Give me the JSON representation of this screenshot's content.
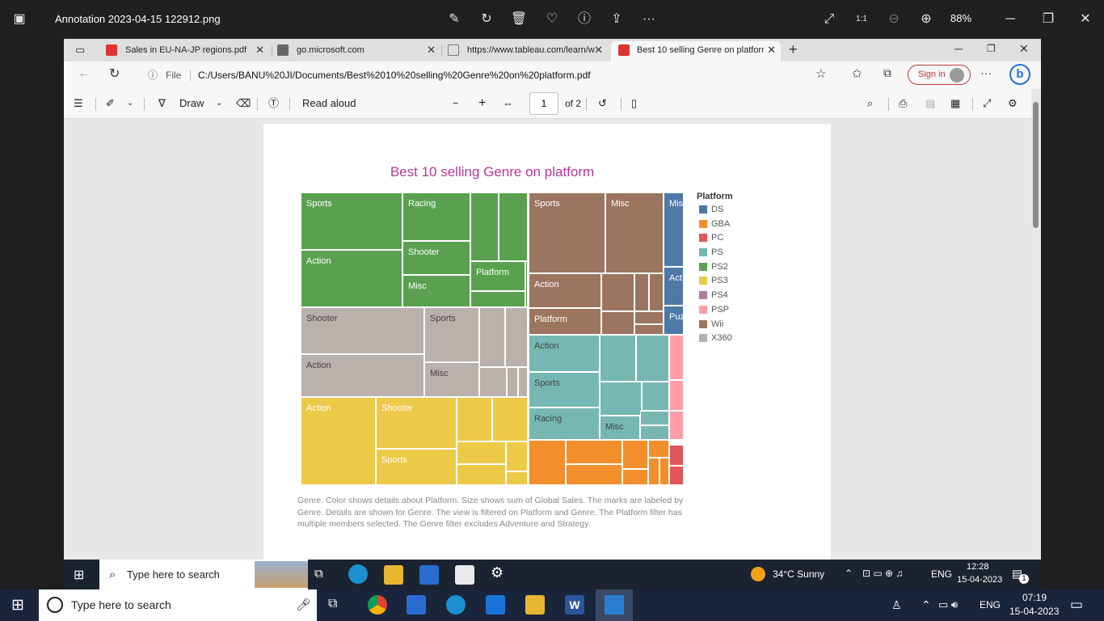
{
  "viewer": {
    "file_name": "Annotation 2023-04-15 122912.png",
    "zoom": "88%"
  },
  "tabs": [
    {
      "label": "Sales in EU-NA-JP regions.pdf",
      "icon": "pdf-icon"
    },
    {
      "label": "go.microsoft.com",
      "icon": "page-icon"
    },
    {
      "label": "https://www.tableau.com/learn/w",
      "icon": "page-icon"
    },
    {
      "label": "Best 10 selling Genre on platform",
      "icon": "pdf-icon",
      "active": true
    }
  ],
  "address": {
    "scheme_label": "File",
    "url": "C:/Users/BANU%20JI/Documents/Best%2010%20selling%20Genre%20on%20platform.pdf",
    "sign_in": "Sign in"
  },
  "pdf_toolbar": {
    "draw": "Draw",
    "read_aloud": "Read aloud",
    "minus": "−",
    "plus": "+",
    "page": "1",
    "page_total": "of 2"
  },
  "chart_data": {
    "type": "treemap",
    "title": "Best 10 selling Genre on platform",
    "legend_title": "Platform",
    "legend": [
      {
        "name": "DS",
        "color": "#4e79a7"
      },
      {
        "name": "GBA",
        "color": "#f28e2b"
      },
      {
        "name": "PC",
        "color": "#e15759"
      },
      {
        "name": "PS",
        "color": "#76b7b2"
      },
      {
        "name": "PS2",
        "color": "#59a14f"
      },
      {
        "name": "PS3",
        "color": "#edc948"
      },
      {
        "name": "PS4",
        "color": "#b07aa1"
      },
      {
        "name": "PSP",
        "color": "#ff9da7"
      },
      {
        "name": "Wii",
        "color": "#9c755f"
      },
      {
        "name": "X360",
        "color": "#bab0ac"
      }
    ],
    "labels": {
      "ps2_sports": "Sports",
      "ps2_racing": "Racing",
      "ps2_action": "Action",
      "ps2_shooter": "Shooter",
      "ps2_platform": "Platform",
      "ps2_misc": "Misc",
      "x360_shooter": "Shooter",
      "x360_sports": "Sports",
      "x360_action": "Action",
      "x360_misc": "Misc",
      "ps3_action": "Action",
      "ps3_shooter": "Shooter",
      "ps3_sports": "Sports",
      "wii_sports": "Sports",
      "wii_misc": "Misc",
      "wii_action": "Action",
      "wii_platform": "Platform",
      "ds_misc": "Mis",
      "ds_action": "Act",
      "ds_puzzle": "Puz",
      "ps_action": "Action",
      "ps_sports": "Sports",
      "ps_racing": "Racing",
      "ps_misc": "Misc"
    },
    "caption": "Genre.  Color shows details about Platform.  Size shows sum of Global Sales.  The marks are labeled by Genre.  Details are shown for Genre. The view is filtered on Platform and Genre. The Platform filter has multiple members selected. The Genre filter excludes Adventure and Strategy."
  },
  "inner_taskbar": {
    "search_placeholder": "Type here to search",
    "weather": "34°C  Sunny",
    "lang": "ENG",
    "time": "12:28",
    "date": "15-04-2023",
    "notif_count": "1"
  },
  "taskbar": {
    "search_placeholder": "Type here to search",
    "lang": "ENG",
    "time": "07:19",
    "date": "15-04-2023"
  }
}
